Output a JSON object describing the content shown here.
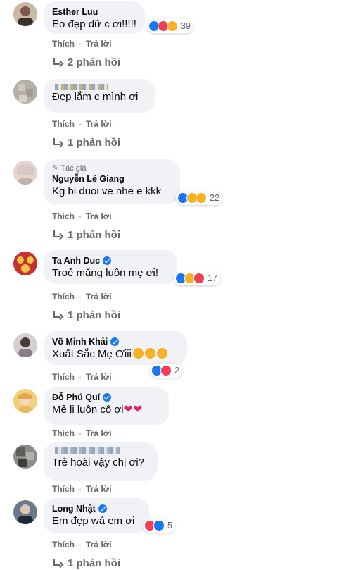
{
  "actions": {
    "like_label": "Thích",
    "reply_label": "Trả lời",
    "dot": "·"
  },
  "comments": [
    {
      "author": "Esther Luu",
      "text": "Eo đẹp dữ c ơi!!!!!",
      "reactions_count": "39",
      "time": "",
      "replies_label": "2 phản hồi"
    },
    {
      "author": "",
      "text": "Đẹp lắm c mình ơi",
      "reactions_count": "",
      "time": "",
      "replies_label": "1 phản hồi"
    },
    {
      "badge": "Tác giả",
      "author": "Nguyễn Lê Giang",
      "text": "Kg bi duoi ve nhe e kkk",
      "reactions_count": "22",
      "time": "",
      "replies_label": "1 phản hồi"
    },
    {
      "author": "Ta Anh Duc",
      "text": "Troẻ măng luôn mẹ ơi!",
      "reactions_count": "17",
      "time": "",
      "replies_label": "1 phản hồi"
    },
    {
      "author": "Võ Minh Khải",
      "text": "Xuất Sắc Mẹ Ơiii",
      "reactions_count": "2",
      "time": "",
      "replies_label": ""
    },
    {
      "author": "Đỗ Phú Quí",
      "text": "Mê li luôn cô ơi",
      "reactions_count": "",
      "time": "",
      "replies_label": ""
    },
    {
      "author": "",
      "text": "Trẻ hoài vậy chị ơi?",
      "reactions_count": "",
      "time": "",
      "replies_label": ""
    },
    {
      "author": "Long Nhật",
      "text": "Em đẹp wá em ơi",
      "reactions_count": "5",
      "time": "",
      "replies_label": "1 phản hồi"
    }
  ],
  "icons": {
    "reply": "reply-arrow-icon",
    "verified": "verified-badge-icon",
    "pin": "pin-icon"
  },
  "colors": {
    "bubble": "#f0f2f5",
    "secondary_text": "#65676b",
    "like_blue": "#1877f2",
    "love_red": "#f33e58",
    "haha_yellow": "#f7b125"
  }
}
